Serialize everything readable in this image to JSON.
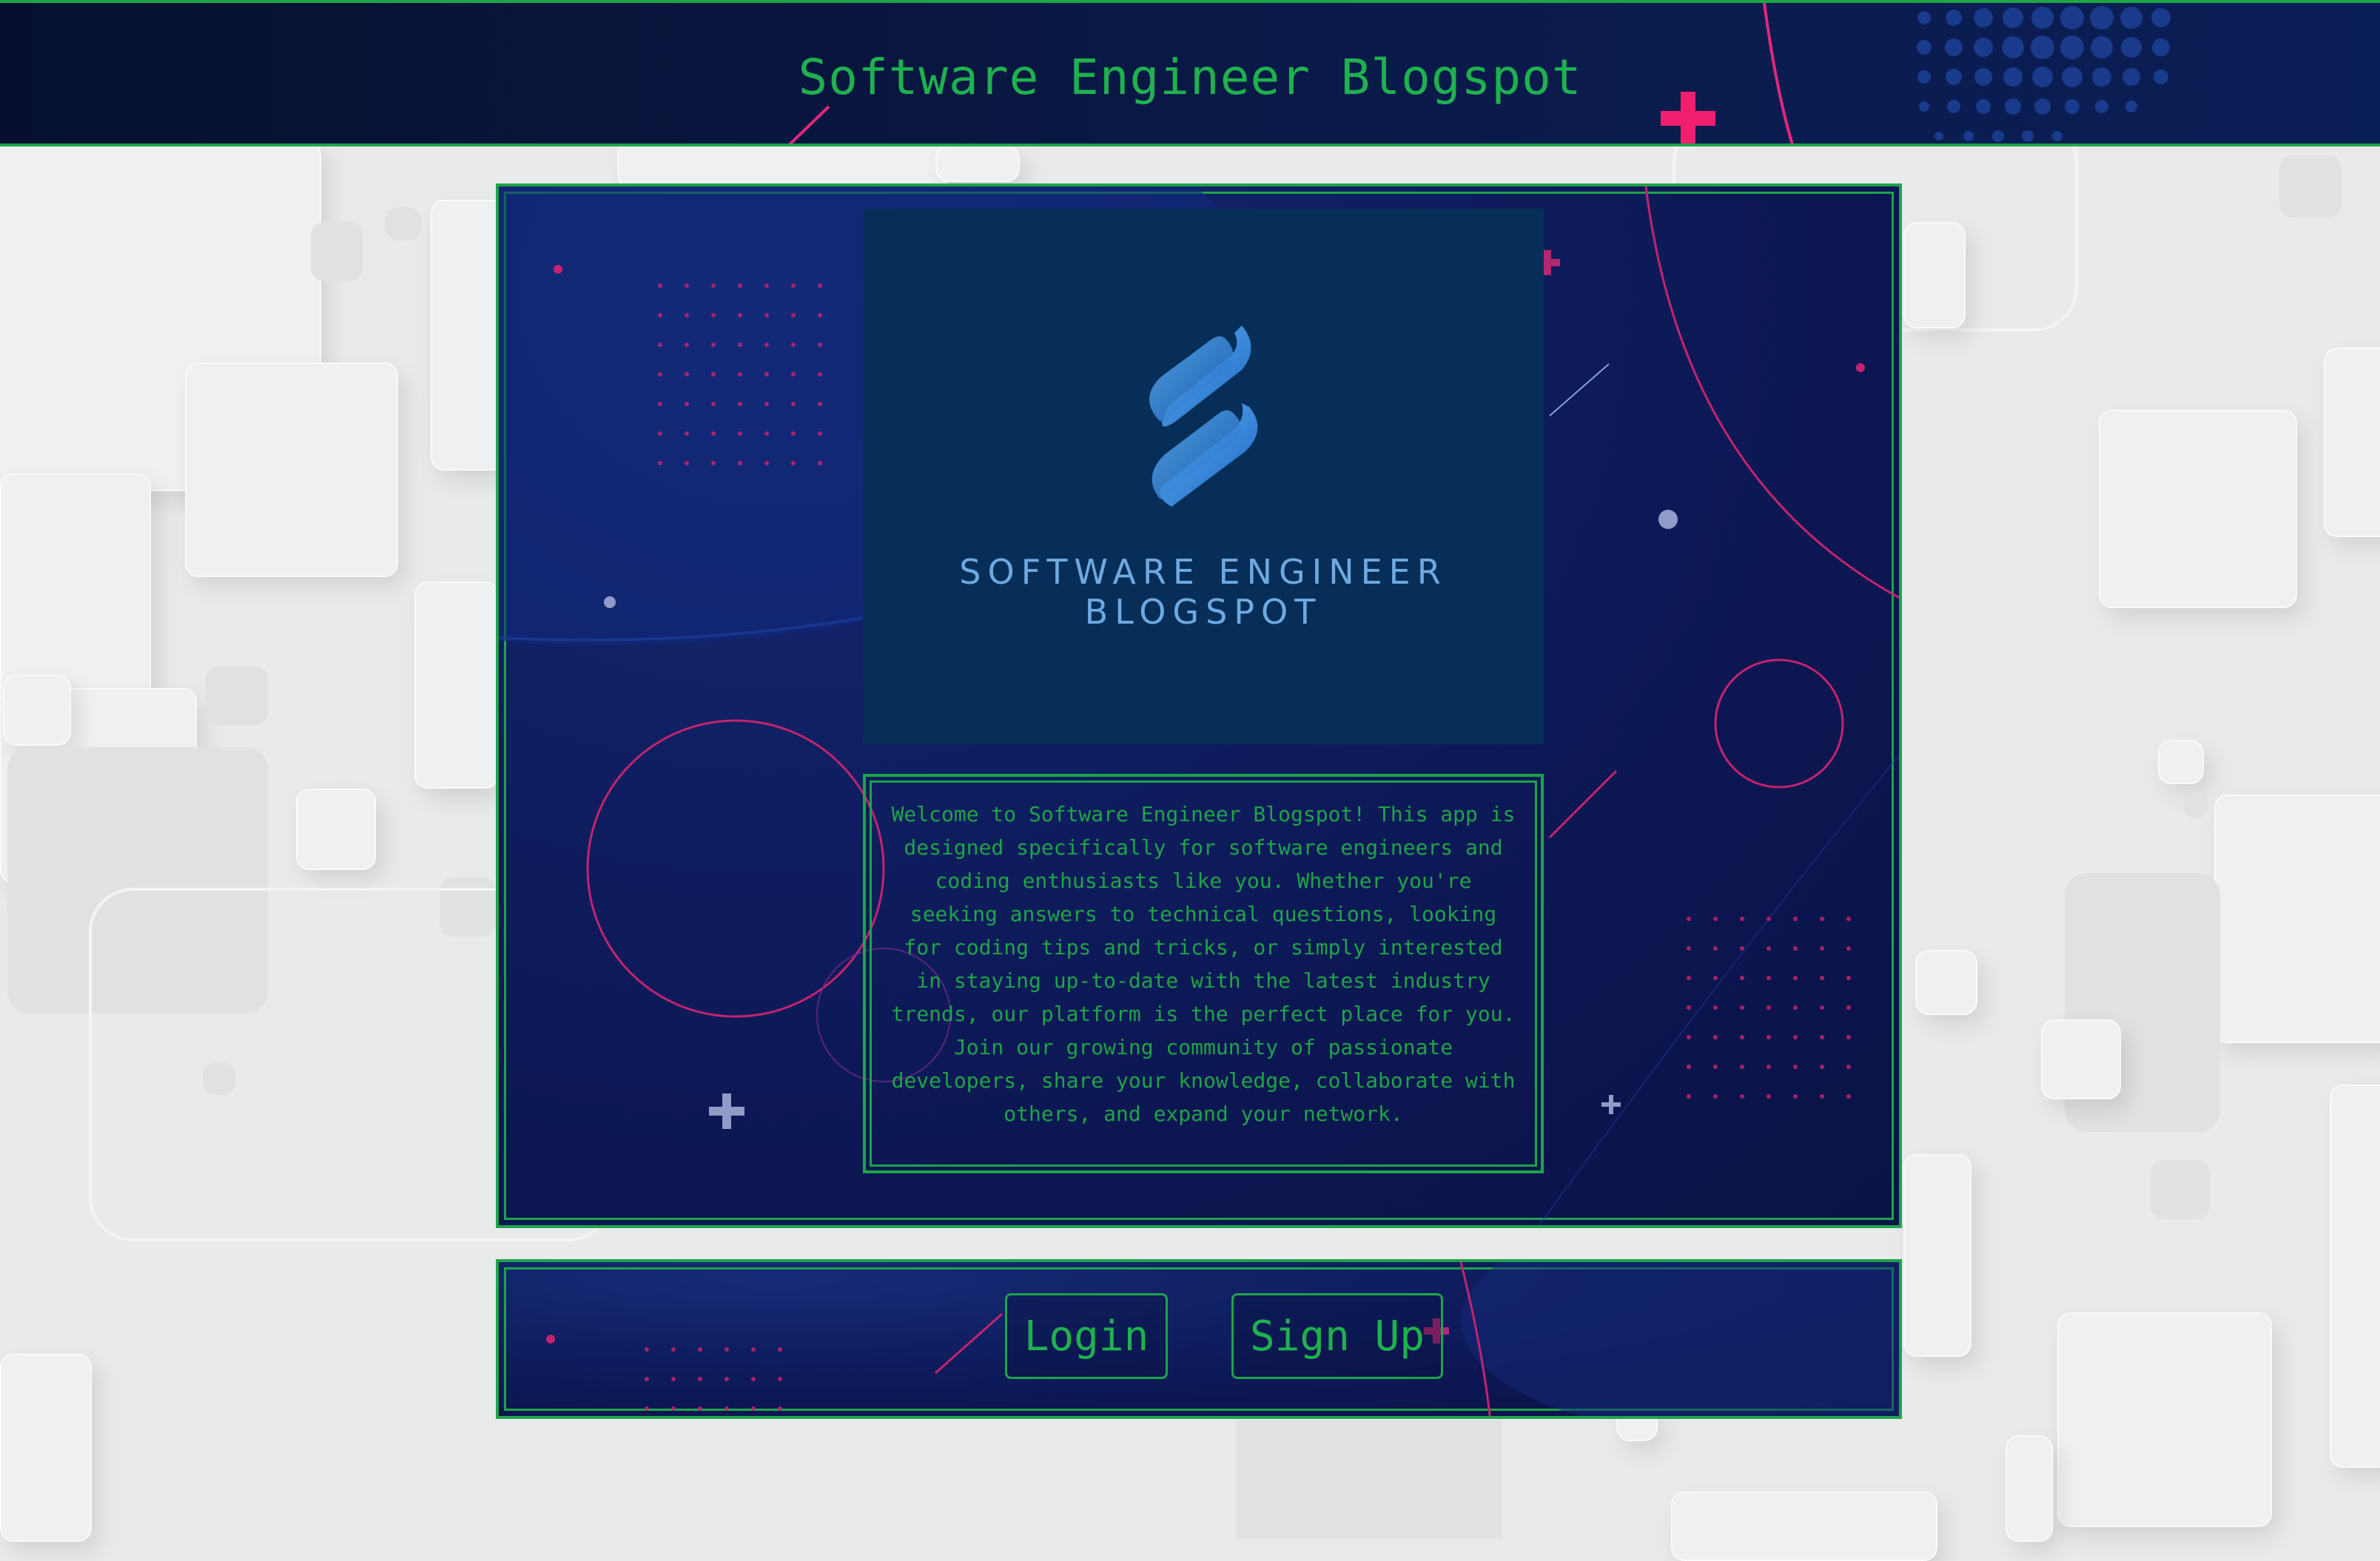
{
  "header": {
    "title": "Software Engineer Blogspot"
  },
  "logo": {
    "alt_text": "SOFTWARE ENGINEER BLOGSPOT"
  },
  "description": "Welcome to Software Engineer Blogspot! This app is designed specifically for software engineers and coding enthusiasts like you. Whether you're seeking answers to technical questions, looking for coding tips and tricks, or simply interested in staying up-to-date with the latest industry trends, our platform is the perfect place for you. Join our growing community of passionate developers, share your knowledge, collaborate with others, and expand your network.",
  "actions": {
    "login_label": "Login",
    "signup_label": "Sign Up"
  },
  "colors": {
    "accent_green": "#1fa447",
    "panel_navy": "#0c1651",
    "logo_bg": "#062e58",
    "logo_text": "#6fa9e0",
    "pink": "#e0287a"
  }
}
